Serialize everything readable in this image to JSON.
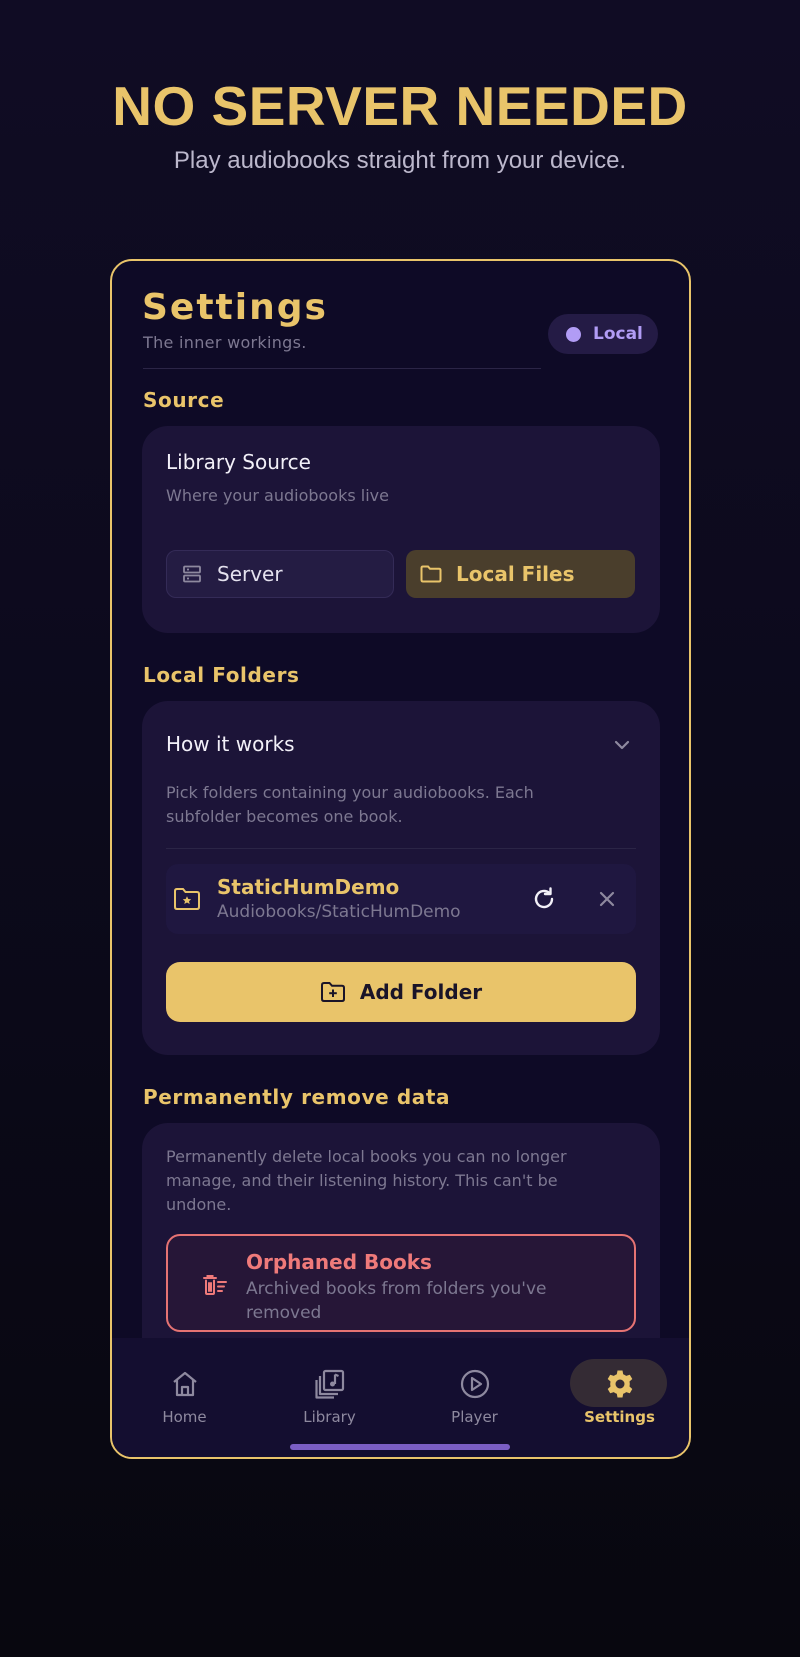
{
  "hero": {
    "title": "NO SERVER NEEDED",
    "subtitle": "Play audiobooks straight from your device."
  },
  "header": {
    "title": "Settings",
    "subtitle": "The inner workings.",
    "badge": "Local"
  },
  "source": {
    "section_label": "Source",
    "title": "Library Source",
    "subtitle": "Where your audiobooks live",
    "options": [
      {
        "label": "Server",
        "icon": "server-icon"
      },
      {
        "label": "Local Files",
        "icon": "folder-icon"
      }
    ],
    "selected": "Local Files"
  },
  "local_folders": {
    "section_label": "Local Folders",
    "how_it_works_title": "How it works",
    "how_it_works_desc": "Pick folders containing your audiobooks. Each subfolder becomes one book.",
    "folders": [
      {
        "name": "StaticHumDemo",
        "path": "Audiobooks/StaticHumDemo"
      }
    ],
    "add_button": "Add Folder"
  },
  "remove_data": {
    "section_label": "Permanently remove data",
    "description": "Permanently delete local books you can no longer manage, and their listening history. This can't be undone.",
    "orphaned_title": "Orphaned Books",
    "orphaned_subtitle": "Archived books from folders you've removed"
  },
  "nav": {
    "items": [
      {
        "label": "Home",
        "icon": "home-icon"
      },
      {
        "label": "Library",
        "icon": "library-icon"
      },
      {
        "label": "Player",
        "icon": "play-icon"
      },
      {
        "label": "Settings",
        "icon": "gear-icon"
      }
    ],
    "active": "Settings"
  },
  "colors": {
    "accent": "#e9c46a",
    "badge": "#b19cf5",
    "danger": "#e57373",
    "background": "#0e0a26",
    "card": "#1c1438"
  }
}
